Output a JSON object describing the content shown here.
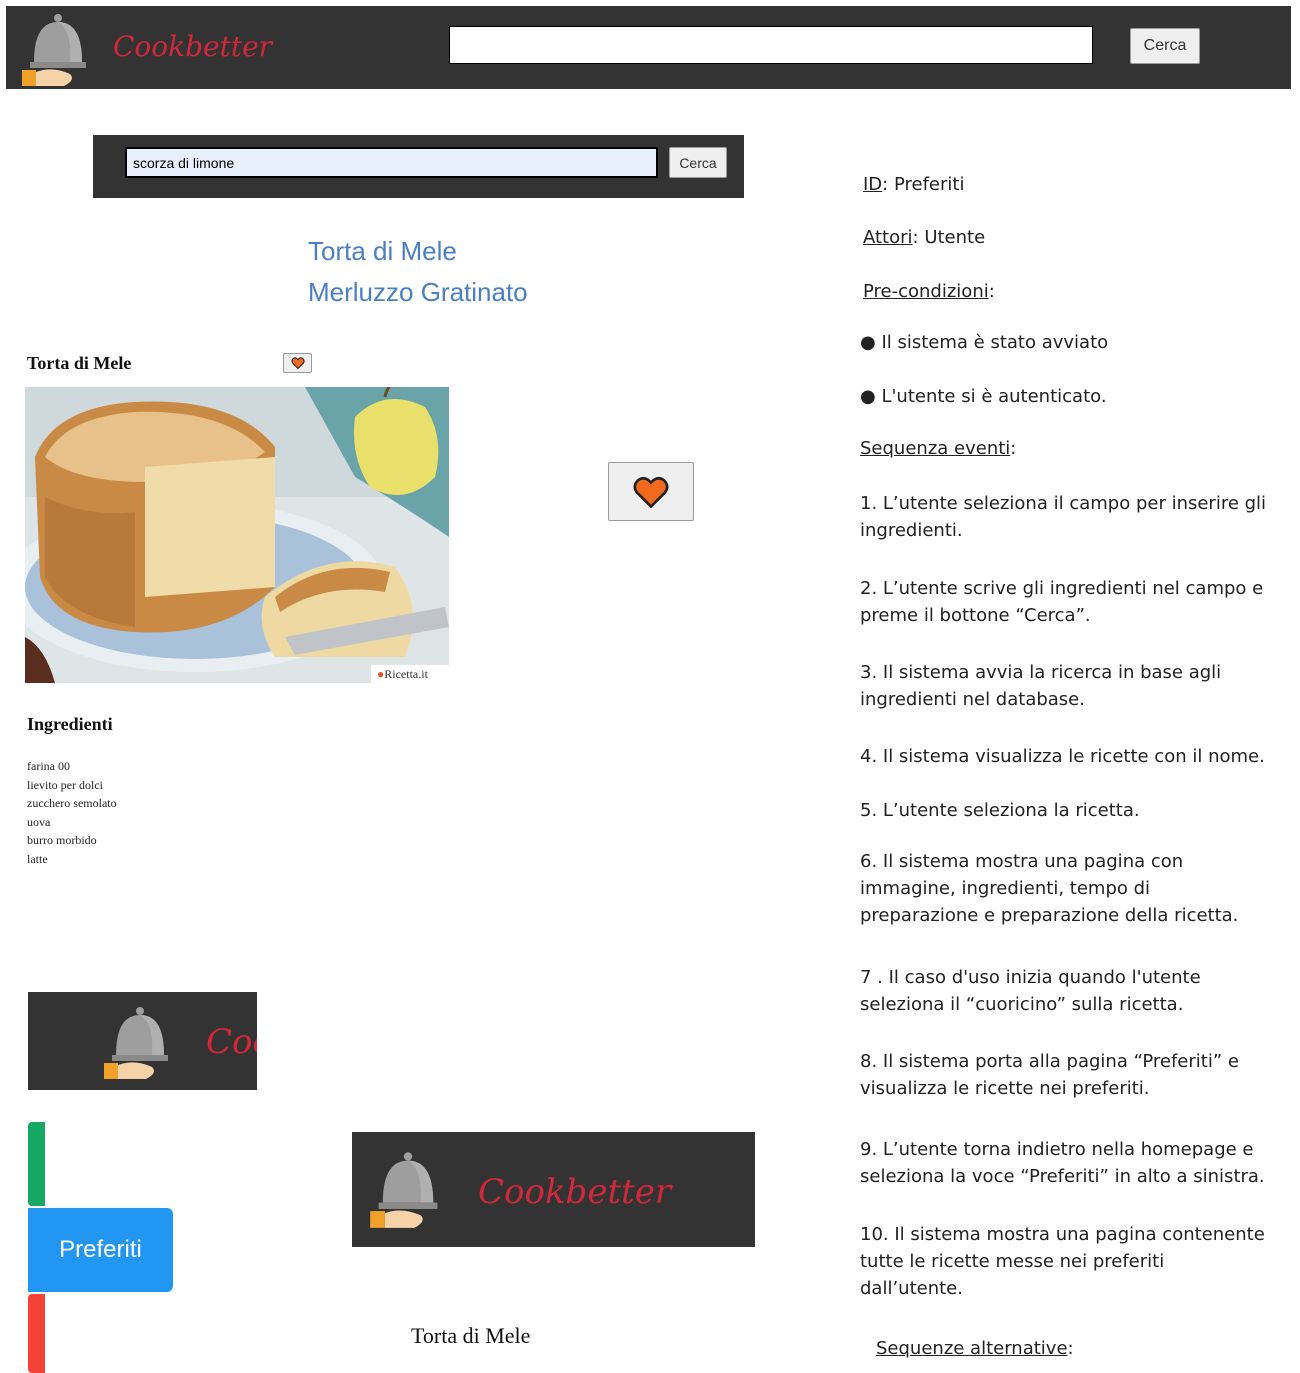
{
  "brand": {
    "name": "Cookbetter",
    "partial_name": "Cook"
  },
  "topbar": {
    "search_value": "",
    "search_button": "Cerca"
  },
  "search_bar": {
    "value": "scorza di limone",
    "button": "Cerca"
  },
  "results": [
    "Torta di Mele",
    "Merluzzo Gratinato"
  ],
  "recipe": {
    "title": "Torta di Mele",
    "watermark": "Ricetta.it",
    "ingredients_heading": "Ingredienti",
    "ingredients": [
      "farina 00",
      "lievito per dolci",
      "zucchero semolato",
      "uova",
      "burro morbido",
      "latte"
    ]
  },
  "favorites": {
    "button_label": "Preferiti",
    "item": "Torta di Mele"
  },
  "use_case": {
    "id_label": "ID",
    "id_value": ": Preferiti",
    "actors_label": "Attori",
    "actors_value": ": Utente",
    "pre_label": "Pre-condizioni",
    "pre_suffix": ":",
    "preconditions": [
      "Il sistema è stato avviato",
      "L'utente si è autenticato."
    ],
    "seq_label": "Sequenza eventi",
    "seq_suffix": ":",
    "steps": [
      [
        "1. L’utente seleziona il campo per inserire gli",
        "ingredienti."
      ],
      [
        "2. L’utente scrive gli ingredienti nel campo e",
        "preme il bottone “Cerca”."
      ],
      [
        "3. Il sistema avvia la ricerca in base agli",
        "ingredienti nel database."
      ],
      [
        "4. Il sistema visualizza le ricette con il nome."
      ],
      [
        "5. L’utente seleziona la ricetta."
      ],
      [
        "6. Il sistema mostra una pagina con",
        "immagine, ingredienti, tempo di",
        "preparazione e preparazione della ricetta."
      ],
      [
        "7 . Il caso d'uso inizia quando l'utente",
        "seleziona il “cuoricino” sulla ricetta."
      ],
      [
        "8. Il sistema porta alla pagina “Preferiti” e",
        "visualizza le ricette nei preferiti."
      ],
      [
        "9. L’utente torna indietro nella homepage e",
        "seleziona la voce “Preferiti” in alto a sinistra."
      ],
      [
        "10. Il sistema mostra una pagina contenente",
        "tutte le ricette messe nei preferiti",
        "dall’utente."
      ]
    ],
    "alt_label": "Sequenze alternative",
    "alt_suffix": ":"
  },
  "colors": {
    "bar": "#333333",
    "brand_red": "#d0283a",
    "link_blue": "#4a7fc4",
    "heart_orange": "#f26a1b",
    "pref_blue": "#2196f3",
    "strip_green": "#14a863",
    "strip_red": "#f44336"
  },
  "icons": [
    "cloche-logo-icon",
    "heart-icon"
  ]
}
